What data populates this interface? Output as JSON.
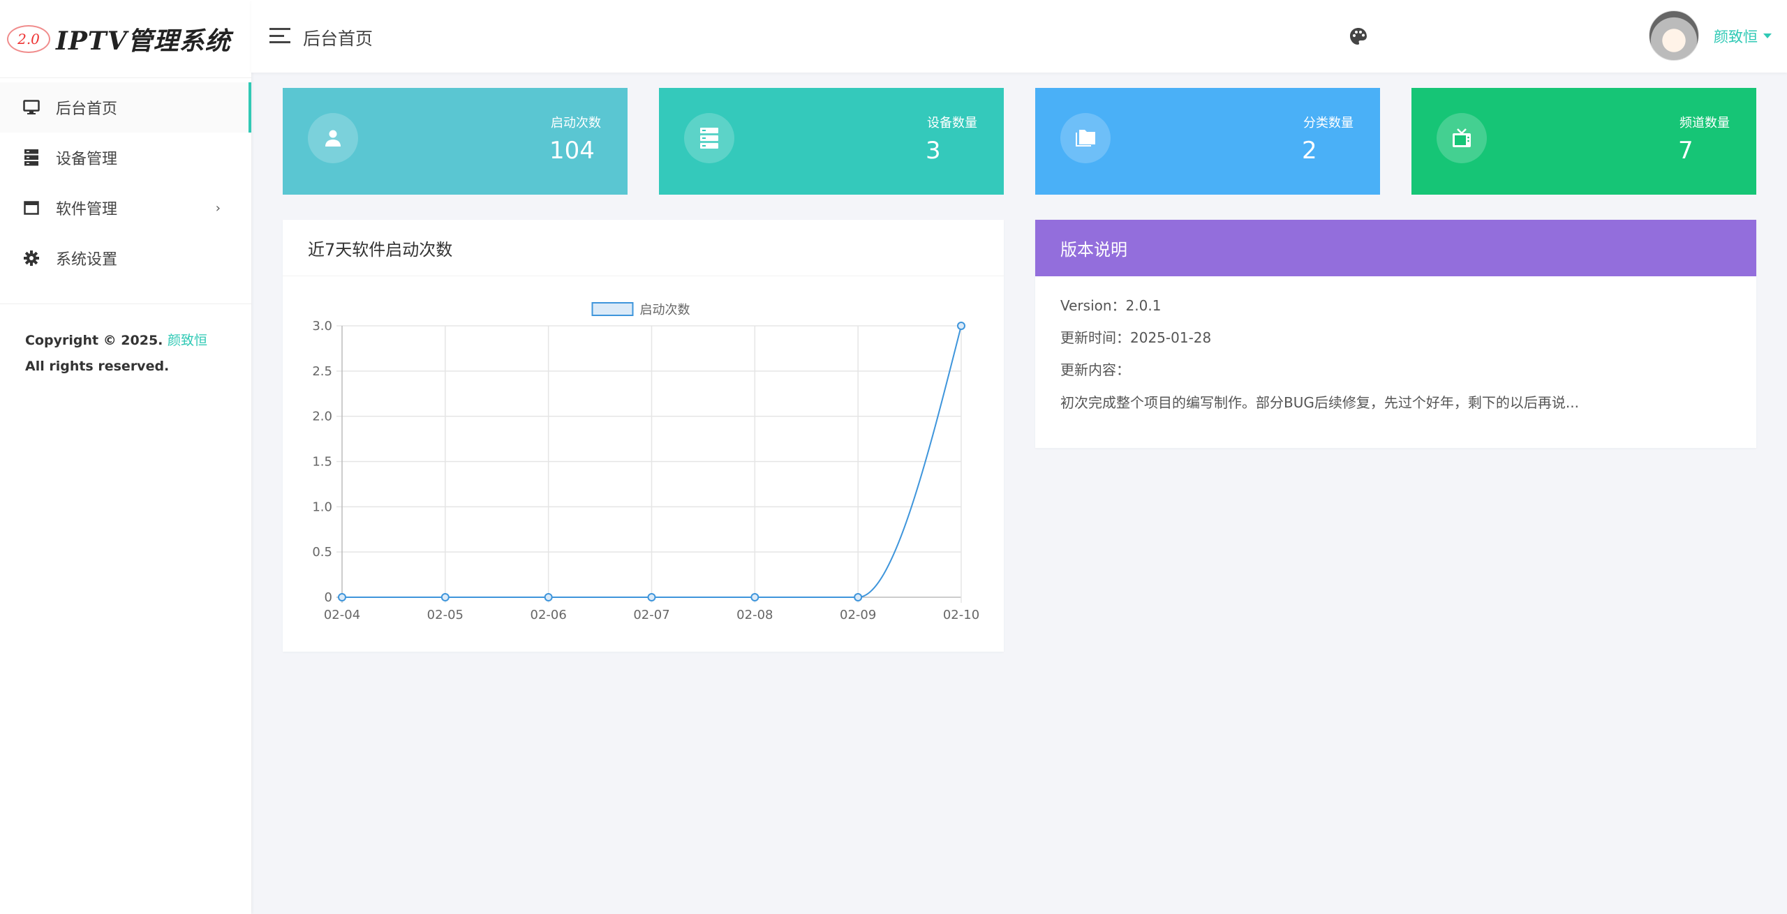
{
  "brand": {
    "badge": "2.0",
    "title": "IPTV管理系统"
  },
  "header": {
    "title": "后台首页",
    "user_name": "颜致恒"
  },
  "sidebar": {
    "items": [
      {
        "label": "后台首页",
        "icon": "monitor-icon",
        "active": true
      },
      {
        "label": "设备管理",
        "icon": "server-icon"
      },
      {
        "label": "软件管理",
        "icon": "window-icon",
        "has_submenu": true
      },
      {
        "label": "系统设置",
        "icon": "gear-icon"
      }
    ],
    "copyright_prefix": "Copyright © 2025.",
    "copyright_author": "颜致恒",
    "copyright_suffix": "All rights reserved."
  },
  "stats": [
    {
      "label": "启动次数",
      "value": "104",
      "icon": "user-icon",
      "color": "#5ac6d2"
    },
    {
      "label": "设备数量",
      "value": "3",
      "icon": "server-icon",
      "color": "#34c9bb"
    },
    {
      "label": "分类数量",
      "value": "2",
      "icon": "folder-icon",
      "color": "#4ab0f7"
    },
    {
      "label": "频道数量",
      "value": "7",
      "icon": "tv-icon",
      "color": "#16c576"
    }
  ],
  "chart_card": {
    "title": "近7天软件启动次数"
  },
  "chart_data": {
    "type": "line",
    "categories": [
      "02-04",
      "02-05",
      "02-06",
      "02-07",
      "02-08",
      "02-09",
      "02-10"
    ],
    "series": [
      {
        "name": "启动次数",
        "values": [
          0,
          0,
          0,
          0,
          0,
          0,
          3
        ],
        "color": "#3e95db"
      }
    ],
    "ylim": [
      0,
      3
    ],
    "yticks": [
      "0",
      "0.5",
      "1.0",
      "1.5",
      "2.0",
      "2.5",
      "3.0"
    ],
    "grid": true,
    "legend": "top"
  },
  "version": {
    "title": "版本说明",
    "version_line": "Version：2.0.1",
    "updated_line": "更新时间：2025-01-28",
    "content_label": "更新内容：",
    "content": "初次完成整个项目的编写制作。部分BUG后续修复，先过个好年，剩下的以后再说..."
  }
}
